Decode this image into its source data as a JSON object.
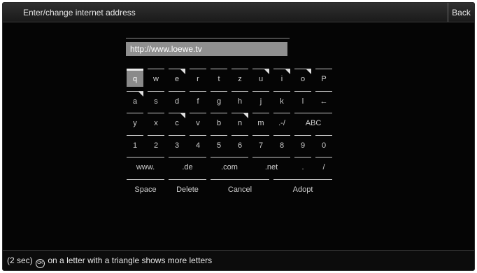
{
  "title": "Enter/change internet address",
  "back_label": "Back",
  "address": {
    "value": "http://www.loewe.tv"
  },
  "keyboard": {
    "rows": [
      {
        "keys": [
          {
            "label": "q",
            "selected": true
          },
          {
            "label": "w"
          },
          {
            "label": "e",
            "more": true
          },
          {
            "label": "r"
          },
          {
            "label": "t"
          },
          {
            "label": "z"
          },
          {
            "label": "u",
            "more": true
          },
          {
            "label": "i",
            "more": true
          },
          {
            "label": "o",
            "more": true
          },
          {
            "label": "P"
          }
        ]
      },
      {
        "keys": [
          {
            "label": "a",
            "more": true
          },
          {
            "label": "s"
          },
          {
            "label": "d"
          },
          {
            "label": "f"
          },
          {
            "label": "g"
          },
          {
            "label": "h"
          },
          {
            "label": "j"
          },
          {
            "label": "k"
          },
          {
            "label": "l"
          },
          {
            "label": "←"
          }
        ]
      },
      {
        "keys": [
          {
            "label": "y"
          },
          {
            "label": "x"
          },
          {
            "label": "c",
            "more": true
          },
          {
            "label": "v"
          },
          {
            "label": "b"
          },
          {
            "label": "n",
            "more": true
          },
          {
            "label": "m"
          },
          {
            "label": ".-/"
          },
          {
            "label": "ABC",
            "span": 2
          }
        ]
      },
      {
        "keys": [
          {
            "label": "1"
          },
          {
            "label": "2"
          },
          {
            "label": "3"
          },
          {
            "label": "4"
          },
          {
            "label": "5"
          },
          {
            "label": "6"
          },
          {
            "label": "7"
          },
          {
            "label": "8"
          },
          {
            "label": "9"
          },
          {
            "label": "0"
          }
        ]
      },
      {
        "keys": [
          {
            "label": "www.",
            "span": 2
          },
          {
            "label": ".de",
            "span": 2
          },
          {
            "label": ".com",
            "span": 2
          },
          {
            "label": ".net",
            "span": 2
          },
          {
            "label": ".",
            "span": 1
          },
          {
            "label": "/",
            "span": 1
          }
        ]
      },
      {
        "keys": [
          {
            "label": "Space",
            "span": 2
          },
          {
            "label": "Delete",
            "span": 2
          },
          {
            "label": "Cancel",
            "span": 3
          },
          {
            "label": "Adopt",
            "span": 3
          }
        ]
      }
    ]
  },
  "footer": {
    "prefix": "(2 sec)",
    "ok_icon_text": "OK",
    "suffix": "on a letter with a triangle shows more letters"
  }
}
